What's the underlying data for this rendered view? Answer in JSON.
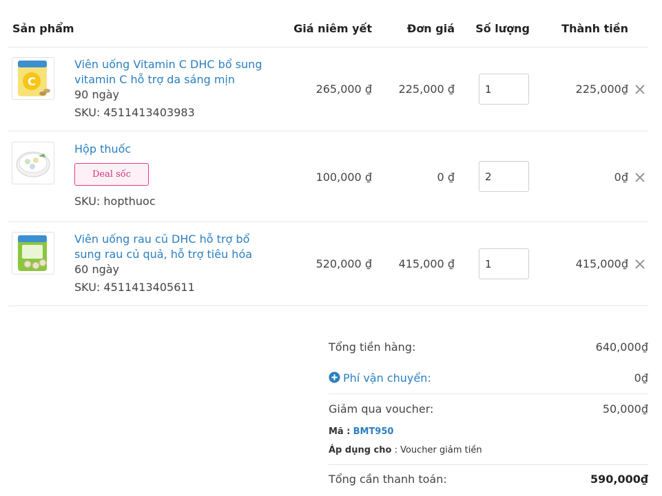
{
  "table": {
    "headers": {
      "product": "Sản phẩm",
      "list_price": "Giá niêm yết",
      "unit_price": "Đơn giá",
      "quantity": "Số lượng",
      "total": "Thành tiền"
    }
  },
  "items": [
    {
      "name": "Viên uống Vitamin C DHC bổ sung vitamin C hỗ trợ da sáng mịn",
      "variant": "90 ngày",
      "sku": "SKU: 4511413403983",
      "list_price": "265,000 ₫",
      "unit_price": "225,000 ₫",
      "quantity": "1",
      "total": "225,000₫",
      "image_icon": "vitamin-c-package"
    },
    {
      "name": "Hộp thuốc",
      "badge": "Deal sốc",
      "sku": "SKU: hopthuoc",
      "list_price": "100,000 ₫",
      "unit_price": "0 ₫",
      "quantity": "2",
      "total": "0₫",
      "image_icon": "pill-box"
    },
    {
      "name": "Viên uống rau củ DHC hỗ trợ bổ sung rau củ quả, hỗ trợ tiêu hóa",
      "variant": "60 ngày",
      "sku": "SKU: 4511413405611",
      "list_price": "520,000 ₫",
      "unit_price": "415,000 ₫",
      "quantity": "1",
      "total": "415,000₫",
      "image_icon": "vegetable-package"
    }
  ],
  "summary": {
    "subtotal_label": "Tổng tiền hàng:",
    "subtotal_value": "640,000₫",
    "shipping_label": "Phí vận chuyển:",
    "shipping_value": "0₫",
    "voucher_label": "Giảm qua voucher:",
    "voucher_value": "50,000₫",
    "code_label": "Mã :",
    "code_value": "BMT950",
    "apply_label": "Áp dụng cho",
    "apply_value": " : Voucher giảm tiền",
    "total_label": "Tổng cần thanh toán:",
    "total_value": "590,000₫"
  },
  "colors": {
    "link": "#2a7fc1",
    "deal_badge": "#e8388a",
    "divider": "#e6e6e6"
  }
}
